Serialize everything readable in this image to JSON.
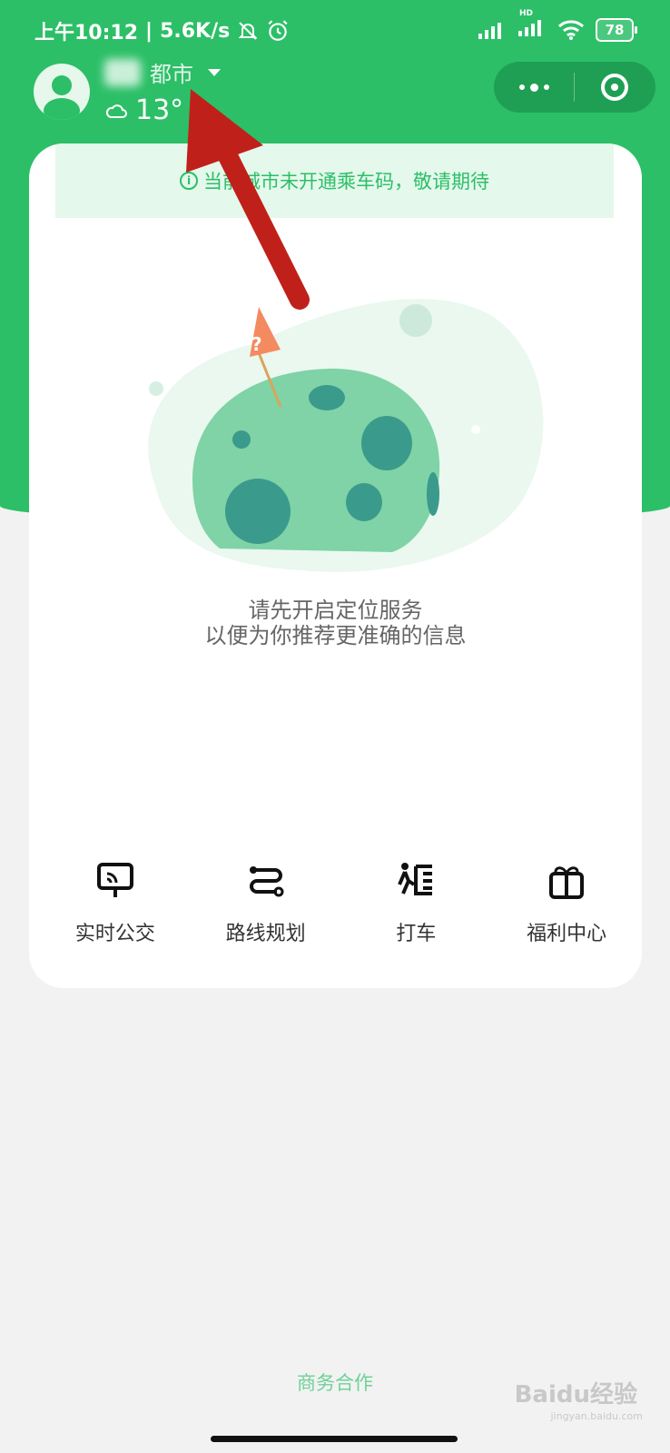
{
  "status_bar": {
    "time": "上午10:12",
    "net_speed": "5.6K/s",
    "signal_label": "HD",
    "battery": "78"
  },
  "header": {
    "city_suffix": "都市",
    "temperature": "13°",
    "weather_icon": "cloud-icon"
  },
  "capsule": {
    "more_icon": "more-dots-icon",
    "close_icon": "target-close-icon"
  },
  "card": {
    "notice": "当前城市未开通乘车码，敬请期待",
    "message_line1": "请先开启定位服务",
    "message_line2": "以便为你推荐更准确的信息",
    "shortcuts": [
      {
        "label": "实时公交",
        "icon": "bus-sign-icon"
      },
      {
        "label": "路线规划",
        "icon": "route-icon"
      },
      {
        "label": "打车",
        "icon": "taxi-person-icon"
      },
      {
        "label": "福利中心",
        "icon": "gift-icon"
      }
    ]
  },
  "footer": {
    "business_link": "商务合作",
    "watermark": "Baidu经验",
    "watermark_sub": "jingyan.baidu.com"
  },
  "colors": {
    "brand_green": "#2cbf67",
    "notice_bg": "#e4f8ec",
    "arrow_red": "#c0201a"
  }
}
